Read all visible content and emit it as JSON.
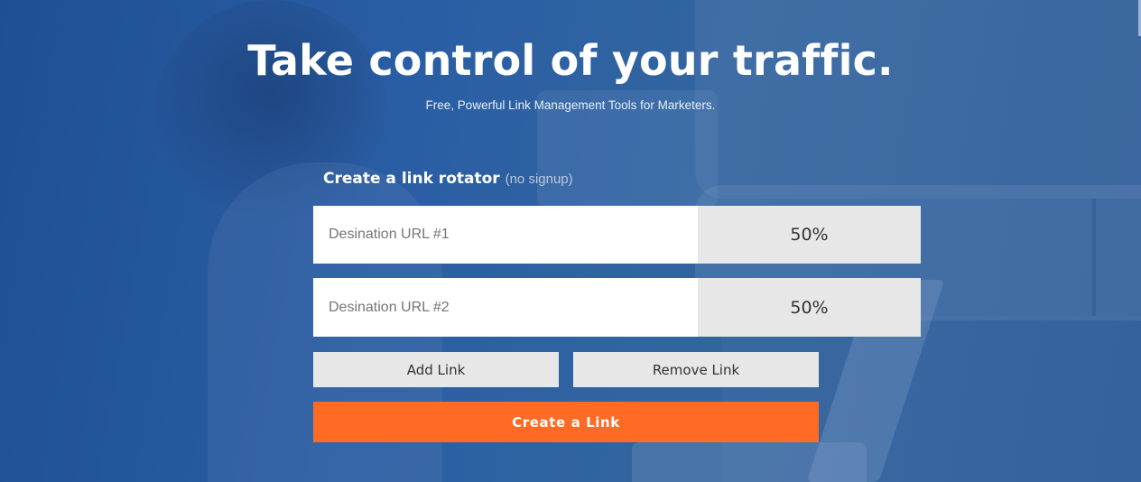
{
  "hero": {
    "headline": "Take control of your traffic.",
    "subheadline": "Free, Powerful Link Management Tools for Marketers."
  },
  "form": {
    "title": "Create a link rotator",
    "title_note": "(no signup)",
    "rows": [
      {
        "placeholder": "Desination URL #1",
        "percent": "50%"
      },
      {
        "placeholder": "Desination URL #2",
        "percent": "50%"
      }
    ],
    "add_label": "Add Link",
    "remove_label": "Remove Link",
    "submit_label": "Create a Link"
  },
  "colors": {
    "background": "#2a5ea4",
    "accent": "#ff6a24",
    "button_gray": "#e7e7e7"
  }
}
